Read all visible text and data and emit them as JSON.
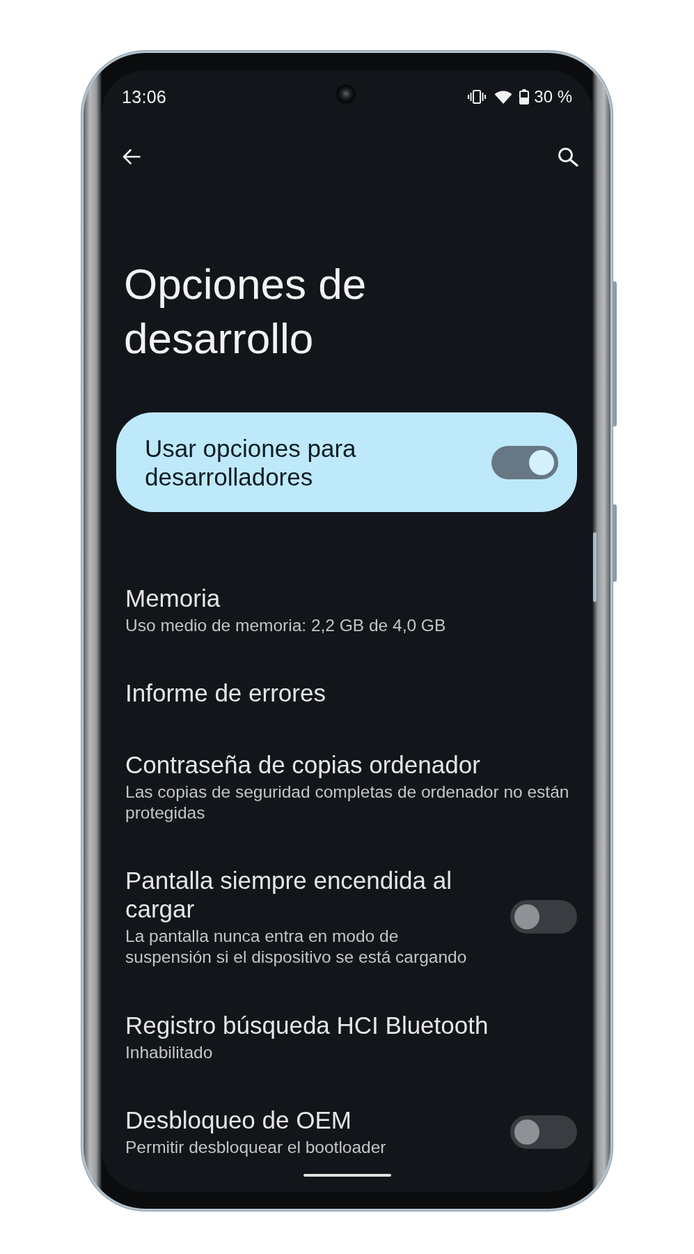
{
  "status_bar": {
    "time": "13:06",
    "battery": "30 %"
  },
  "title": "Opciones de desarrollo",
  "main_switch": {
    "label": "Usar opciones para desarrolladores",
    "on": true
  },
  "items": [
    {
      "kind": "text",
      "title": "Memoria",
      "subtitle": "Uso medio de memoria: 2,2 GB de 4,0 GB"
    },
    {
      "kind": "text",
      "title": "Informe de errores"
    },
    {
      "kind": "text",
      "title": "Contraseña de copias ordenador",
      "subtitle": "Las copias de seguridad completas de ordenador no están protegidas"
    },
    {
      "kind": "switch",
      "title": "Pantalla siempre encendida al cargar",
      "subtitle": "La pantalla nunca entra en modo de suspensión si el dispositivo se está cargando",
      "on": false
    },
    {
      "kind": "text",
      "title": "Registro búsqueda HCI Bluetooth",
      "subtitle": "Inhabilitado"
    },
    {
      "kind": "switch",
      "title": "Desbloqueo de OEM",
      "subtitle": "Permitir desbloquear el bootloader",
      "on": false
    }
  ]
}
